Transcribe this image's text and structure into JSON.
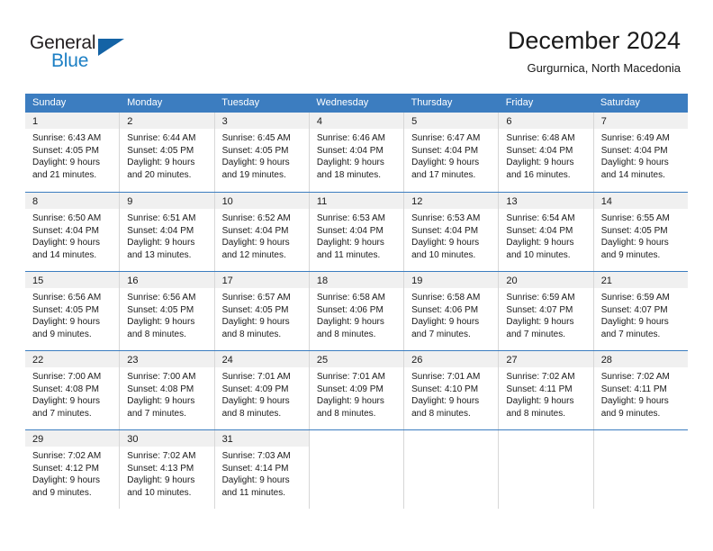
{
  "logo": {
    "word_top": "General",
    "word_bottom": "Blue",
    "triangle_color": "#1463a5",
    "blue_color": "#1c7fc4"
  },
  "header": {
    "month_title": "December 2024",
    "location": "Gurgurnica, North Macedonia"
  },
  "theme": {
    "header_blue": "#3c7dc0",
    "band_gray": "#f0f0f0",
    "grid_line": "#d7d7d7"
  },
  "calendar": {
    "day_headers": [
      "Sunday",
      "Monday",
      "Tuesday",
      "Wednesday",
      "Thursday",
      "Friday",
      "Saturday"
    ],
    "weeks": [
      [
        {
          "date": "1",
          "sunrise": "Sunrise: 6:43 AM",
          "sunset": "Sunset: 4:05 PM",
          "daylight_line1": "Daylight: 9 hours",
          "daylight_line2": "and 21 minutes."
        },
        {
          "date": "2",
          "sunrise": "Sunrise: 6:44 AM",
          "sunset": "Sunset: 4:05 PM",
          "daylight_line1": "Daylight: 9 hours",
          "daylight_line2": "and 20 minutes."
        },
        {
          "date": "3",
          "sunrise": "Sunrise: 6:45 AM",
          "sunset": "Sunset: 4:05 PM",
          "daylight_line1": "Daylight: 9 hours",
          "daylight_line2": "and 19 minutes."
        },
        {
          "date": "4",
          "sunrise": "Sunrise: 6:46 AM",
          "sunset": "Sunset: 4:04 PM",
          "daylight_line1": "Daylight: 9 hours",
          "daylight_line2": "and 18 minutes."
        },
        {
          "date": "5",
          "sunrise": "Sunrise: 6:47 AM",
          "sunset": "Sunset: 4:04 PM",
          "daylight_line1": "Daylight: 9 hours",
          "daylight_line2": "and 17 minutes."
        },
        {
          "date": "6",
          "sunrise": "Sunrise: 6:48 AM",
          "sunset": "Sunset: 4:04 PM",
          "daylight_line1": "Daylight: 9 hours",
          "daylight_line2": "and 16 minutes."
        },
        {
          "date": "7",
          "sunrise": "Sunrise: 6:49 AM",
          "sunset": "Sunset: 4:04 PM",
          "daylight_line1": "Daylight: 9 hours",
          "daylight_line2": "and 14 minutes."
        }
      ],
      [
        {
          "date": "8",
          "sunrise": "Sunrise: 6:50 AM",
          "sunset": "Sunset: 4:04 PM",
          "daylight_line1": "Daylight: 9 hours",
          "daylight_line2": "and 14 minutes."
        },
        {
          "date": "9",
          "sunrise": "Sunrise: 6:51 AM",
          "sunset": "Sunset: 4:04 PM",
          "daylight_line1": "Daylight: 9 hours",
          "daylight_line2": "and 13 minutes."
        },
        {
          "date": "10",
          "sunrise": "Sunrise: 6:52 AM",
          "sunset": "Sunset: 4:04 PM",
          "daylight_line1": "Daylight: 9 hours",
          "daylight_line2": "and 12 minutes."
        },
        {
          "date": "11",
          "sunrise": "Sunrise: 6:53 AM",
          "sunset": "Sunset: 4:04 PM",
          "daylight_line1": "Daylight: 9 hours",
          "daylight_line2": "and 11 minutes."
        },
        {
          "date": "12",
          "sunrise": "Sunrise: 6:53 AM",
          "sunset": "Sunset: 4:04 PM",
          "daylight_line1": "Daylight: 9 hours",
          "daylight_line2": "and 10 minutes."
        },
        {
          "date": "13",
          "sunrise": "Sunrise: 6:54 AM",
          "sunset": "Sunset: 4:04 PM",
          "daylight_line1": "Daylight: 9 hours",
          "daylight_line2": "and 10 minutes."
        },
        {
          "date": "14",
          "sunrise": "Sunrise: 6:55 AM",
          "sunset": "Sunset: 4:05 PM",
          "daylight_line1": "Daylight: 9 hours",
          "daylight_line2": "and 9 minutes."
        }
      ],
      [
        {
          "date": "15",
          "sunrise": "Sunrise: 6:56 AM",
          "sunset": "Sunset: 4:05 PM",
          "daylight_line1": "Daylight: 9 hours",
          "daylight_line2": "and 9 minutes."
        },
        {
          "date": "16",
          "sunrise": "Sunrise: 6:56 AM",
          "sunset": "Sunset: 4:05 PM",
          "daylight_line1": "Daylight: 9 hours",
          "daylight_line2": "and 8 minutes."
        },
        {
          "date": "17",
          "sunrise": "Sunrise: 6:57 AM",
          "sunset": "Sunset: 4:05 PM",
          "daylight_line1": "Daylight: 9 hours",
          "daylight_line2": "and 8 minutes."
        },
        {
          "date": "18",
          "sunrise": "Sunrise: 6:58 AM",
          "sunset": "Sunset: 4:06 PM",
          "daylight_line1": "Daylight: 9 hours",
          "daylight_line2": "and 8 minutes."
        },
        {
          "date": "19",
          "sunrise": "Sunrise: 6:58 AM",
          "sunset": "Sunset: 4:06 PM",
          "daylight_line1": "Daylight: 9 hours",
          "daylight_line2": "and 7 minutes."
        },
        {
          "date": "20",
          "sunrise": "Sunrise: 6:59 AM",
          "sunset": "Sunset: 4:07 PM",
          "daylight_line1": "Daylight: 9 hours",
          "daylight_line2": "and 7 minutes."
        },
        {
          "date": "21",
          "sunrise": "Sunrise: 6:59 AM",
          "sunset": "Sunset: 4:07 PM",
          "daylight_line1": "Daylight: 9 hours",
          "daylight_line2": "and 7 minutes."
        }
      ],
      [
        {
          "date": "22",
          "sunrise": "Sunrise: 7:00 AM",
          "sunset": "Sunset: 4:08 PM",
          "daylight_line1": "Daylight: 9 hours",
          "daylight_line2": "and 7 minutes."
        },
        {
          "date": "23",
          "sunrise": "Sunrise: 7:00 AM",
          "sunset": "Sunset: 4:08 PM",
          "daylight_line1": "Daylight: 9 hours",
          "daylight_line2": "and 7 minutes."
        },
        {
          "date": "24",
          "sunrise": "Sunrise: 7:01 AM",
          "sunset": "Sunset: 4:09 PM",
          "daylight_line1": "Daylight: 9 hours",
          "daylight_line2": "and 8 minutes."
        },
        {
          "date": "25",
          "sunrise": "Sunrise: 7:01 AM",
          "sunset": "Sunset: 4:09 PM",
          "daylight_line1": "Daylight: 9 hours",
          "daylight_line2": "and 8 minutes."
        },
        {
          "date": "26",
          "sunrise": "Sunrise: 7:01 AM",
          "sunset": "Sunset: 4:10 PM",
          "daylight_line1": "Daylight: 9 hours",
          "daylight_line2": "and 8 minutes."
        },
        {
          "date": "27",
          "sunrise": "Sunrise: 7:02 AM",
          "sunset": "Sunset: 4:11 PM",
          "daylight_line1": "Daylight: 9 hours",
          "daylight_line2": "and 8 minutes."
        },
        {
          "date": "28",
          "sunrise": "Sunrise: 7:02 AM",
          "sunset": "Sunset: 4:11 PM",
          "daylight_line1": "Daylight: 9 hours",
          "daylight_line2": "and 9 minutes."
        }
      ],
      [
        {
          "date": "29",
          "sunrise": "Sunrise: 7:02 AM",
          "sunset": "Sunset: 4:12 PM",
          "daylight_line1": "Daylight: 9 hours",
          "daylight_line2": "and 9 minutes."
        },
        {
          "date": "30",
          "sunrise": "Sunrise: 7:02 AM",
          "sunset": "Sunset: 4:13 PM",
          "daylight_line1": "Daylight: 9 hours",
          "daylight_line2": "and 10 minutes."
        },
        {
          "date": "31",
          "sunrise": "Sunrise: 7:03 AM",
          "sunset": "Sunset: 4:14 PM",
          "daylight_line1": "Daylight: 9 hours",
          "daylight_line2": "and 11 minutes."
        },
        {
          "date": "",
          "sunrise": "",
          "sunset": "",
          "daylight_line1": "",
          "daylight_line2": ""
        },
        {
          "date": "",
          "sunrise": "",
          "sunset": "",
          "daylight_line1": "",
          "daylight_line2": ""
        },
        {
          "date": "",
          "sunrise": "",
          "sunset": "",
          "daylight_line1": "",
          "daylight_line2": ""
        },
        {
          "date": "",
          "sunrise": "",
          "sunset": "",
          "daylight_line1": "",
          "daylight_line2": ""
        }
      ]
    ]
  }
}
